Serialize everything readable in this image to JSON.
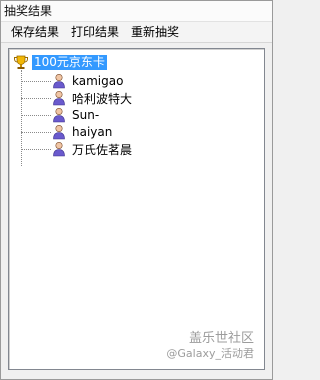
{
  "window": {
    "title": "抽奖结果"
  },
  "menubar": {
    "items": [
      "保存结果",
      "打印结果",
      "重新抽奖"
    ]
  },
  "tree": {
    "root_label": "100元京东卡",
    "root_icon": "trophy-icon",
    "child_icon": "person-icon",
    "children": [
      "kamigao",
      "哈利波特大",
      "Sun-",
      "haiyan",
      "万氏佐茗晨"
    ]
  },
  "watermark": {
    "main": "盖乐世社区",
    "sub": "@Galaxy_活动君"
  },
  "colors": {
    "selection": "#3399ff",
    "window_bg": "#f0f0f0",
    "panel_bg": "#ffffff"
  }
}
